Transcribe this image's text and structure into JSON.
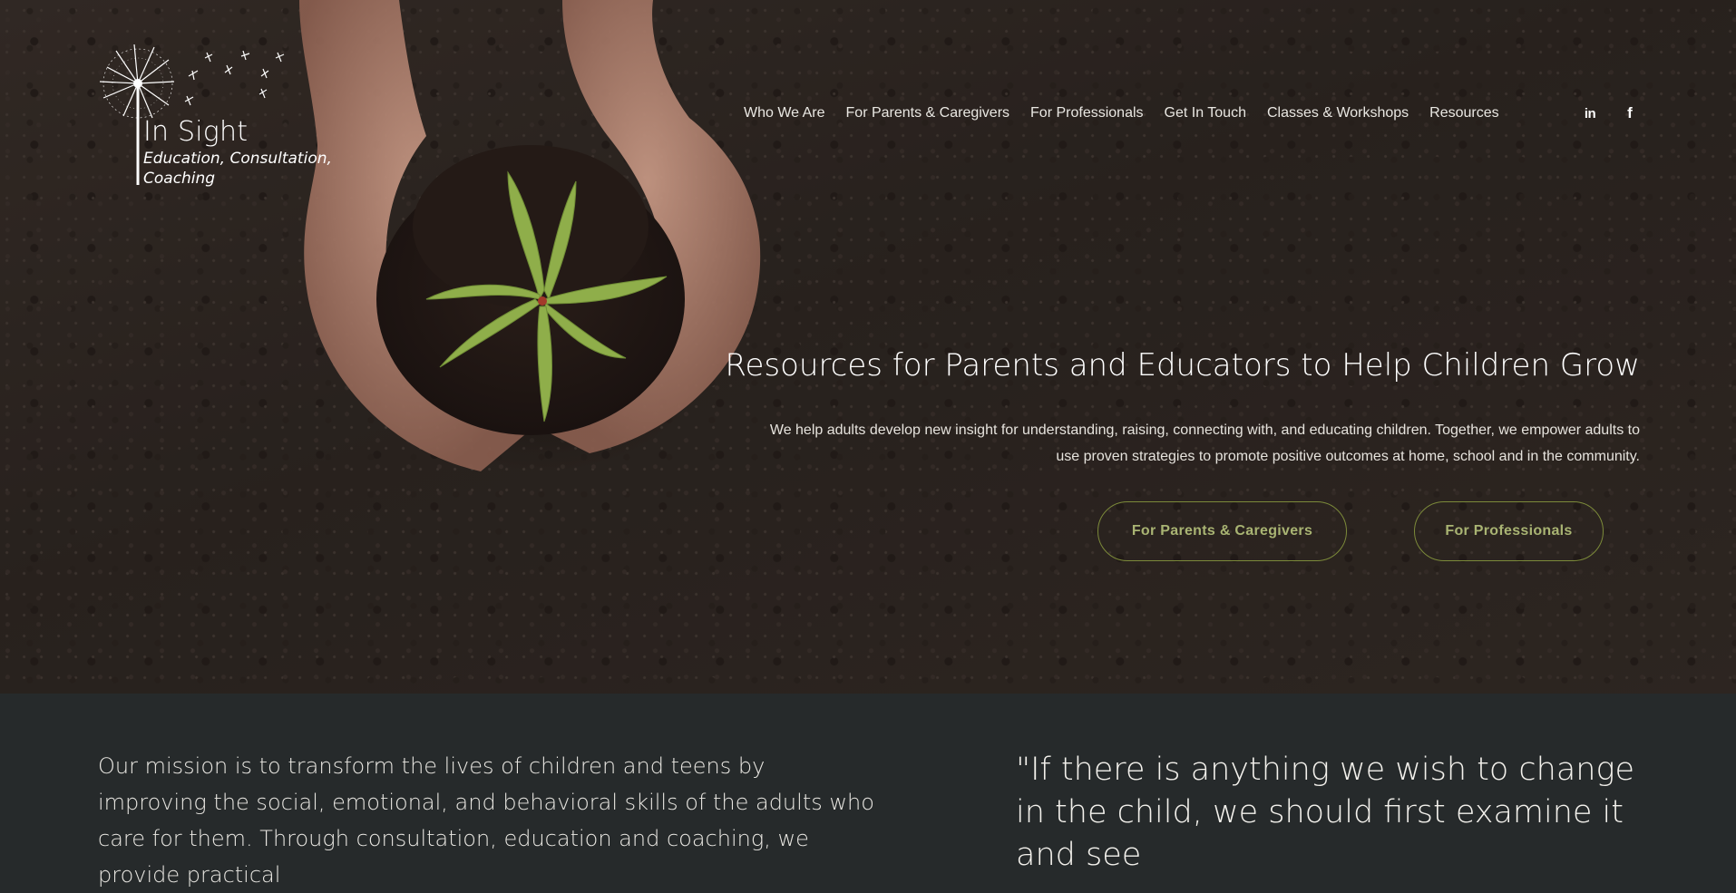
{
  "brand": {
    "name": "In Sight",
    "tagline_line1": "Education, Consultation,",
    "tagline_line2": "Coaching"
  },
  "nav": {
    "items": [
      {
        "label": "Who We Are"
      },
      {
        "label": "For Parents & Caregivers"
      },
      {
        "label": "For Professionals"
      },
      {
        "label": "Get In Touch"
      },
      {
        "label": "Classes & Workshops"
      },
      {
        "label": "Resources"
      }
    ],
    "social": [
      {
        "name": "linkedin-icon",
        "glyph": "in"
      },
      {
        "name": "facebook-icon",
        "glyph": "f"
      }
    ]
  },
  "hero": {
    "title": "Resources for Parents and Educators to Help Children Grow",
    "subtitle": "We help adults develop new insight for understanding, raising, connecting with, and educating children. Together, we empower adults to use proven strategies to promote positive outcomes at home, school and in the community.",
    "buttons": [
      {
        "label": "For Parents & Caregivers"
      },
      {
        "label": "For Professionals"
      }
    ],
    "background_image": "hands-holding-seedling-in-soil"
  },
  "mission": {
    "text": "Our mission is to transform the lives of children and teens by improving the social, emotional, and behavioral skills of the adults who care for them. Through consultation, education and coaching, we provide practical"
  },
  "quote": {
    "text": "\"If there is anything we wish to change in the child, we should first examine it and see"
  },
  "colors": {
    "hero_bg": "#2e2622",
    "bottom_bg": "#262a2b",
    "button_accent": "#7c8a3a",
    "button_text": "#a9b473",
    "text_light": "#ffffff"
  }
}
